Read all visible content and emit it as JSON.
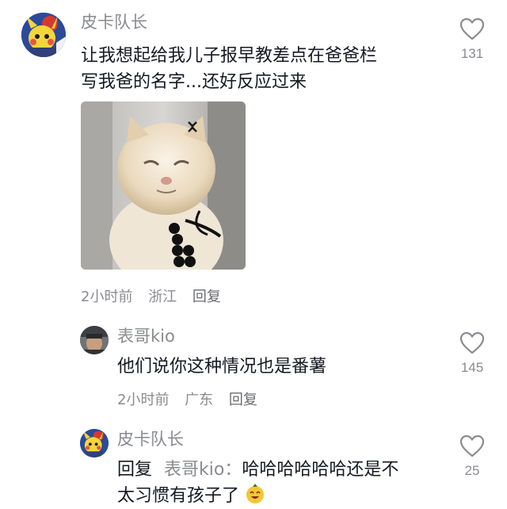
{
  "comments": [
    {
      "username": "皮卡队长",
      "text_line1": "让我想起给我儿子报早教差点在爸爸栏",
      "text_line2": "写我爸的名字...还好反应过来",
      "time": "2小时前",
      "location": "浙江",
      "reply_label": "回复",
      "likes": "131",
      "avatar_icon": "pikachu-avatar-icon",
      "image_icon": "cat-meme-image"
    },
    {
      "username": "表哥kio",
      "text": "他们说你这种情况也是番薯",
      "time": "2小时前",
      "location": "广东",
      "reply_label": "回复",
      "likes": "145",
      "avatar_icon": "user-avatar-icon"
    },
    {
      "username": "皮卡队长",
      "reply_prefix": "回复",
      "reply_to": "表哥kio：",
      "text_line1": "哈哈哈哈哈哈还是不",
      "text_line2": "太习惯有孩子了",
      "likes": "25",
      "avatar_icon": "pikachu-avatar-icon"
    }
  ],
  "colors": {
    "text": "#161823",
    "muted": "#8a8b91",
    "heart": "#8a8b91"
  }
}
